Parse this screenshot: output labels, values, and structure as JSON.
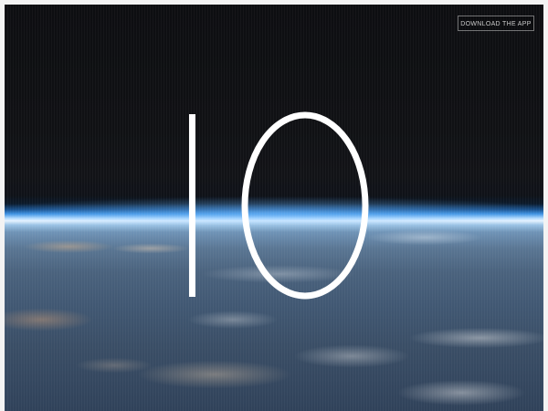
{
  "header": {
    "download_button_label": "DOWNLOAD THE APP"
  },
  "hero": {
    "title": "IO"
  },
  "colors": {
    "hero_text": "#ffffff",
    "button_text": "#c9c9c9",
    "space": "#101114",
    "horizon": "#3a8fe0"
  }
}
